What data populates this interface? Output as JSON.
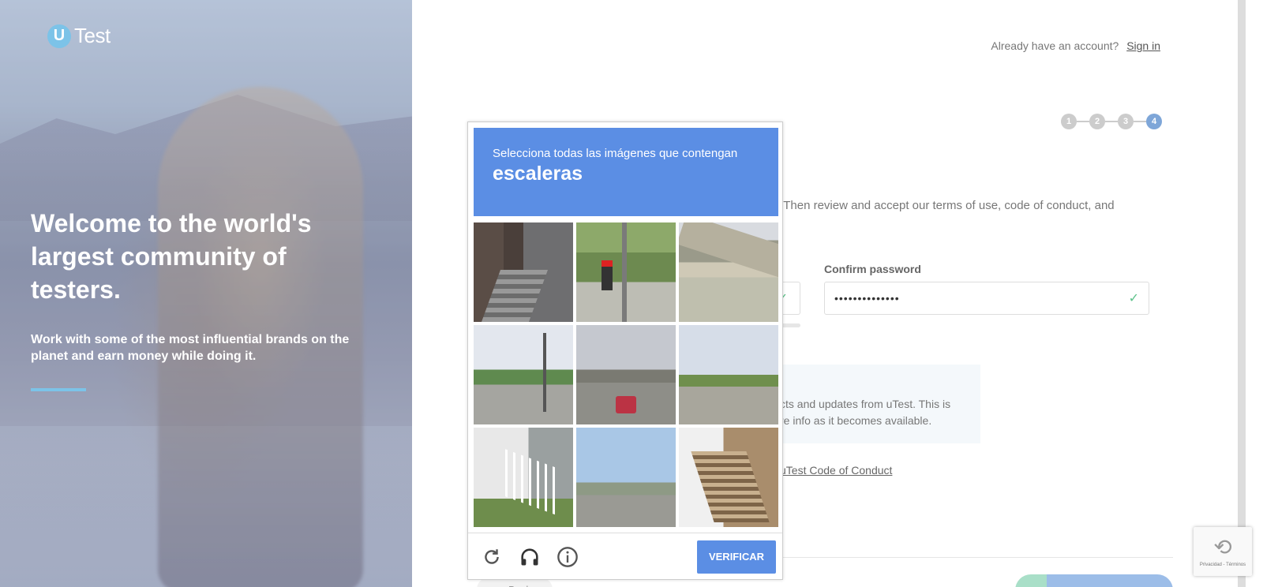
{
  "hero": {
    "logo_letter": "U",
    "logo_text": "Test",
    "title": "Welcome to the world's largest community of testers.",
    "subtitle": "Work with some of the most influential brands on the planet and earn money while doing it."
  },
  "header": {
    "account_prompt": "Already have an account?",
    "signin_label": "Sign in"
  },
  "steps": [
    "1",
    "2",
    "3",
    "4"
  ],
  "form": {
    "intro_fragment": "t. Then review and accept our terms of use, code of conduct, and",
    "confirm_password_label": "Confirm password",
    "confirm_password_value": "••••••••••••••",
    "info_line1": "cts and updates from uTest. This is",
    "info_line2": "re info as it becomes available.",
    "coc_link": "uTest Code of Conduct",
    "back_label": "Back"
  },
  "captcha": {
    "prompt": "Selecciona todas las imágenes que contengan",
    "keyword": "escaleras",
    "verify_label": "VERIFICAR",
    "icons": [
      "reload-icon",
      "headphones-icon",
      "info-icon"
    ]
  },
  "recaptcha_badge": {
    "terms": "Privacidad - Términos"
  },
  "colors": {
    "captcha_blue": "#5b8ee4",
    "brand_light_blue": "#7cc3e8",
    "active_step": "#7ea6d8",
    "valid_green": "#5cc28a"
  }
}
